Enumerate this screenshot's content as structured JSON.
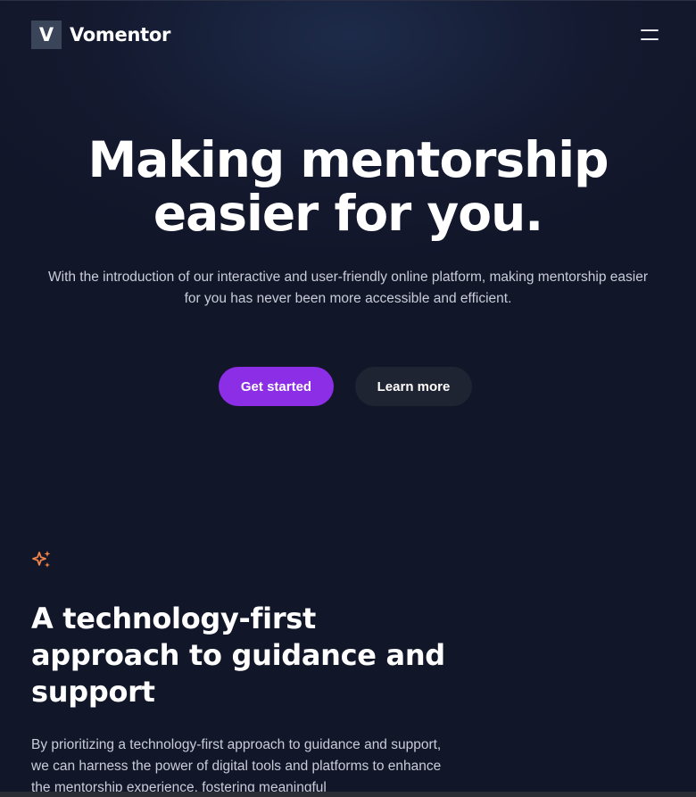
{
  "header": {
    "logo_letter": "V",
    "brand_name": "Vomentor",
    "menu_icon": "hamburger-menu-icon"
  },
  "hero": {
    "title_line1": "Making mentorship",
    "title_line2": "easier for you.",
    "subtitle": "With the introduction of our interactive and user-friendly online platform, making mentorship easier for you has never been more accessible and efficient.",
    "primary_button": "Get started",
    "secondary_button": "Learn more"
  },
  "feature": {
    "icon": "sparkle-icon",
    "title": "A technology-first approach to guidance and support",
    "body": "By prioritizing a technology-first approach to guidance and support, we can harness the power of digital tools and platforms to enhance the mentorship experience, fostering meaningful"
  },
  "colors": {
    "background": "#121629",
    "primary_accent": "#8b2ee6",
    "secondary_button": "#1f2432",
    "sparkle": "#f0844a",
    "logo_mark": "#3a4559"
  }
}
